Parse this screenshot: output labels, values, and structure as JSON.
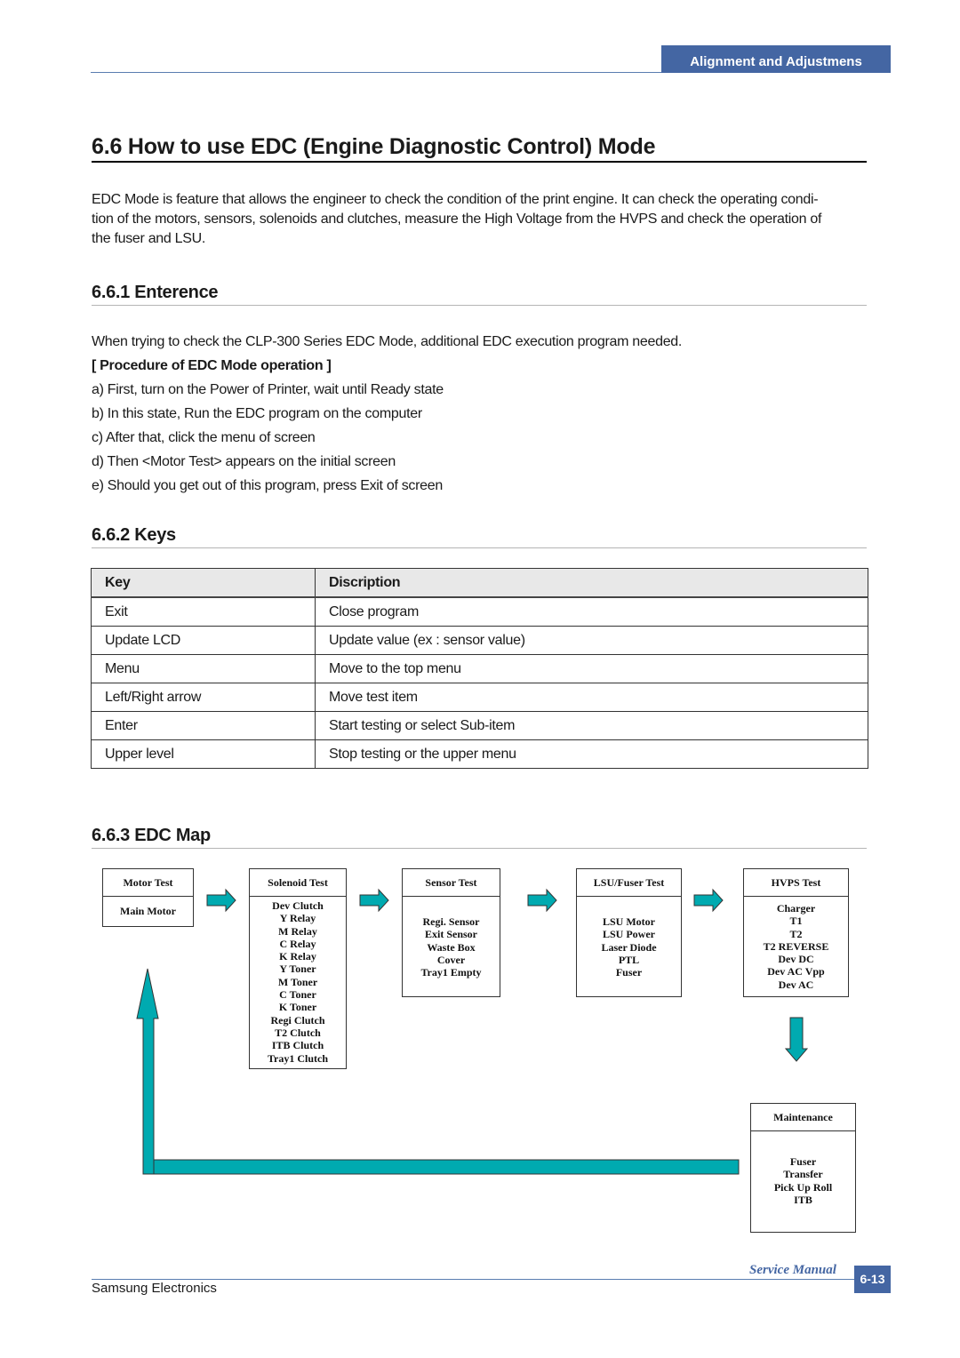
{
  "header": {
    "section_tab": "Alignment and Adjustmens"
  },
  "title": "6.6 How to use EDC (Engine Diagnostic Control) Mode",
  "intro": "EDC Mode is feature that allows the engineer to check the condition of the print engine. It can check the operating condi-tion of the motors, sensors, solenoids and clutches, measure the High Voltage from the HVPS and check the operation of the fuser and LSU.",
  "intro_lines": [
    "EDC Mode is feature that allows the engineer to check the condition of the print engine. It can check the operating condi-",
    "tion of the motors, sensors, solenoids and clutches, measure the High Voltage from the HVPS and check the operation of",
    "the fuser and LSU."
  ],
  "entrance": {
    "heading": "6.6.1 Enterence",
    "text": "When trying to check the CLP-300 Series EDC Mode, additional EDC execution program needed.",
    "procedure_title": "[ Procedure of EDC Mode operation ]",
    "steps": [
      "a) First, turn on the Power of Printer, wait until Ready state",
      "b) In this state, Run the EDC program on the computer",
      "c) After that, click the menu of screen",
      "d) Then <Motor Test> appears on the initial screen",
      "e) Should you get out of this program, press Exit of screen"
    ]
  },
  "keys": {
    "heading": "6.6.2 Keys",
    "columns": [
      "Key",
      "Discription"
    ],
    "rows": [
      [
        "Exit",
        "Close program"
      ],
      [
        "Update LCD",
        "Update value (ex : sensor value)"
      ],
      [
        "Menu",
        "Move to the top menu"
      ],
      [
        "Left/Right arrow",
        "Move test item"
      ],
      [
        "Enter",
        "Start testing or select Sub-item"
      ],
      [
        "Upper level",
        "Stop testing or the upper menu"
      ]
    ]
  },
  "edc_map": {
    "heading": "6.6.3 EDC Map",
    "arrow_color": "#00aab0",
    "boxes": [
      {
        "title": "Motor Test",
        "items": [
          "Main Motor"
        ]
      },
      {
        "title": "Solenoid Test",
        "items": [
          "Dev Clutch",
          "Y Relay",
          "M Relay",
          "C Relay",
          "K Relay",
          "Y Toner",
          "M Toner",
          "C Toner",
          "K Toner",
          "Regi Clutch",
          "T2 Clutch",
          "ITB Clutch",
          "Tray1 Clutch"
        ]
      },
      {
        "title": "Sensor Test",
        "items": [
          "Regi. Sensor",
          "Exit Sensor",
          "Waste Box",
          "Cover",
          "Tray1 Empty"
        ]
      },
      {
        "title": "LSU/Fuser Test",
        "items": [
          "LSU Motor",
          "LSU Power",
          "Laser Diode",
          "PTL",
          "Fuser"
        ]
      },
      {
        "title": "HVPS Test",
        "items": [
          "Charger",
          "T1",
          "T2",
          "T2 REVERSE",
          "Dev DC",
          "Dev AC Vpp",
          "Dev AC"
        ]
      },
      {
        "title": "Maintenance",
        "items": [
          "Fuser",
          "Transfer",
          "Pick Up Roll",
          "ITB"
        ]
      }
    ]
  },
  "footer": {
    "company": "Samsung Electronics",
    "manual": "Service Manual",
    "page": "6-13"
  }
}
